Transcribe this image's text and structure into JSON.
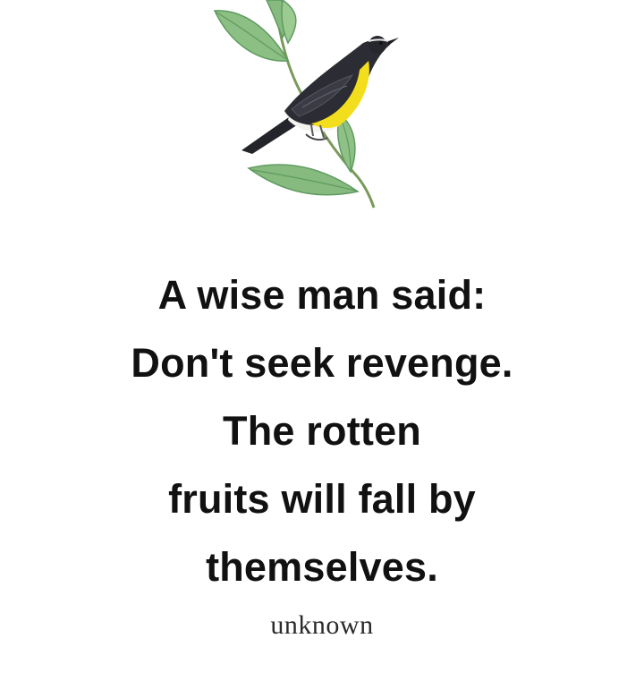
{
  "illustration": {
    "subject": "bird-on-branch",
    "colors": {
      "leaf": "#7fb27a",
      "leaf_dark": "#4f8a55",
      "bird_body": "#2b2b33",
      "bird_breast": "#f1dd23",
      "bird_belly": "#f2f2ee"
    }
  },
  "quote": {
    "lines": [
      "A wise man said:",
      "Don't seek revenge.",
      "The rotten",
      "fruits will fall by",
      "themselves."
    ]
  },
  "author": "unknown"
}
